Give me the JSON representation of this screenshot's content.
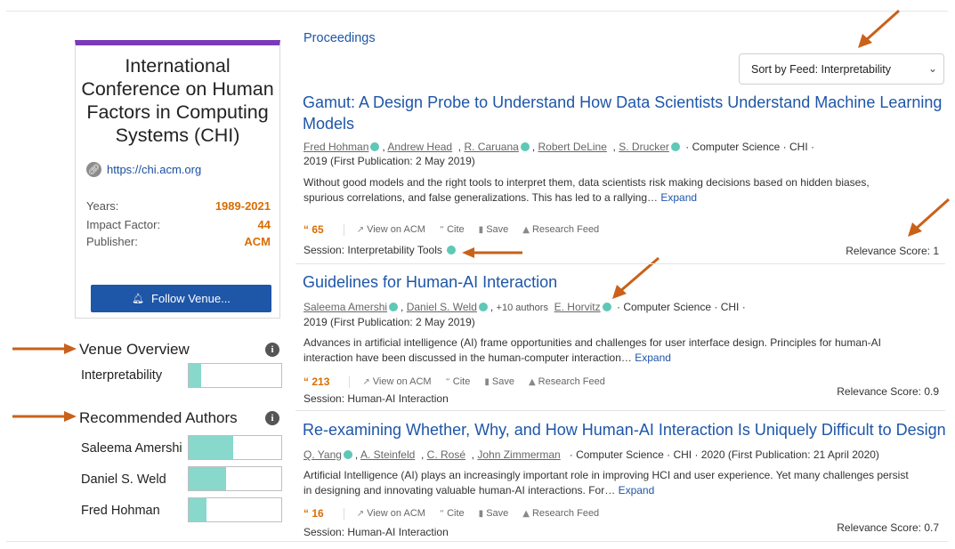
{
  "venue": {
    "name": "International Conference on Human Factors in Computing Systems (CHI)",
    "url": "https://chi.acm.org",
    "years_label": "Years:",
    "years": "1989-2021",
    "impact_label": "Impact Factor:",
    "impact": "44",
    "publisher_label": "Publisher:",
    "publisher": "ACM",
    "follow_label": "Follow Venue...",
    "accent_color": "#7b3ab8"
  },
  "venue_overview": {
    "title": "Venue Overview",
    "items": [
      {
        "label": "Interpretability",
        "fraction": 0.13
      }
    ]
  },
  "recommended_authors": {
    "title": "Recommended Authors",
    "items": [
      {
        "label": "Saleema Amershi",
        "fraction": 0.48
      },
      {
        "label": "Daniel S. Weld",
        "fraction": 0.4
      },
      {
        "label": "Fred Hohman",
        "fraction": 0.19
      }
    ]
  },
  "proceedings_label": "Proceedings",
  "sort": {
    "value": "Sort by Feed: Interpretability"
  },
  "papers": [
    {
      "title_line1": "Gamut: A Design Probe to Understand How Data Scientists Understand Machine Learning",
      "title_line2": "Models",
      "authors": [
        "Fred Hohman",
        "Andrew Head",
        "R. Caruana",
        "Robert DeLine",
        "S. Drucker"
      ],
      "field": "Computer Science",
      "venue": "CHI",
      "date": "2019 (First Publication: 2 May 2019)",
      "abstract_line1": "Without good models and the right tools to interpret them, data scientists risk making decisions based on hidden biases,",
      "abstract_line2": "spurious correlations, and false generalizations. This has led to a rallying…",
      "expand": "Expand",
      "citations": "65",
      "session": "Session: Interpretability Tools",
      "relevance": "Relevance Score: 1"
    },
    {
      "title_line1": "Guidelines for Human-AI Interaction",
      "authors": [
        "Saleema Amershi",
        "Daniel S. Weld",
        "E. Horvitz"
      ],
      "more_authors": "+10 authors",
      "field": "Computer Science",
      "venue": "CHI",
      "date": "2019 (First Publication: 2 May 2019)",
      "abstract_line1": "Advances in artificial intelligence (AI) frame opportunities and challenges for user interface design. Principles for human-AI",
      "abstract_line2": "interaction have been discussed in the human-computer interaction…",
      "expand": "Expand",
      "citations": "213",
      "session": "Session: Human-AI Interaction",
      "relevance": "Relevance Score: 0.9"
    },
    {
      "title_line1": "Re-examining Whether, Why, and How Human-AI Interaction Is Uniquely Difficult to Design",
      "authors": [
        "Q. Yang",
        "A. Steinfeld",
        "C. Rosé",
        "John Zimmerman"
      ],
      "field": "Computer Science",
      "venue": "CHI",
      "year_pub": "2020 (First Publication: 21 April 2020)",
      "abstract_line1": "Artificial Intelligence (AI) plays an increasingly important role in improving HCI and user experience. Yet many challenges persist",
      "abstract_line2": "in designing and innovating valuable human-AI interactions. For…",
      "expand": "Expand",
      "citations": "16",
      "session": "Session: Human-AI Interaction",
      "relevance": "Relevance Score: 0.7"
    }
  ],
  "actions": {
    "view": "View on ACM",
    "cite": "Cite",
    "save": "Save",
    "feed": "Research Feed"
  },
  "colors": {
    "link": "#1e56a8",
    "citation": "#d96d00",
    "bar_fill": "#88d8cc",
    "annotation_arrow": "#c9611a"
  },
  "icons": {
    "link": "link-icon",
    "bell": "bell-icon",
    "info": "info-icon",
    "quote": "quote-icon",
    "view": "external-view-icon",
    "bookmark": "bookmark-icon",
    "thumb": "thumbs-up-icon",
    "chevron": "chevron-down-icon"
  }
}
